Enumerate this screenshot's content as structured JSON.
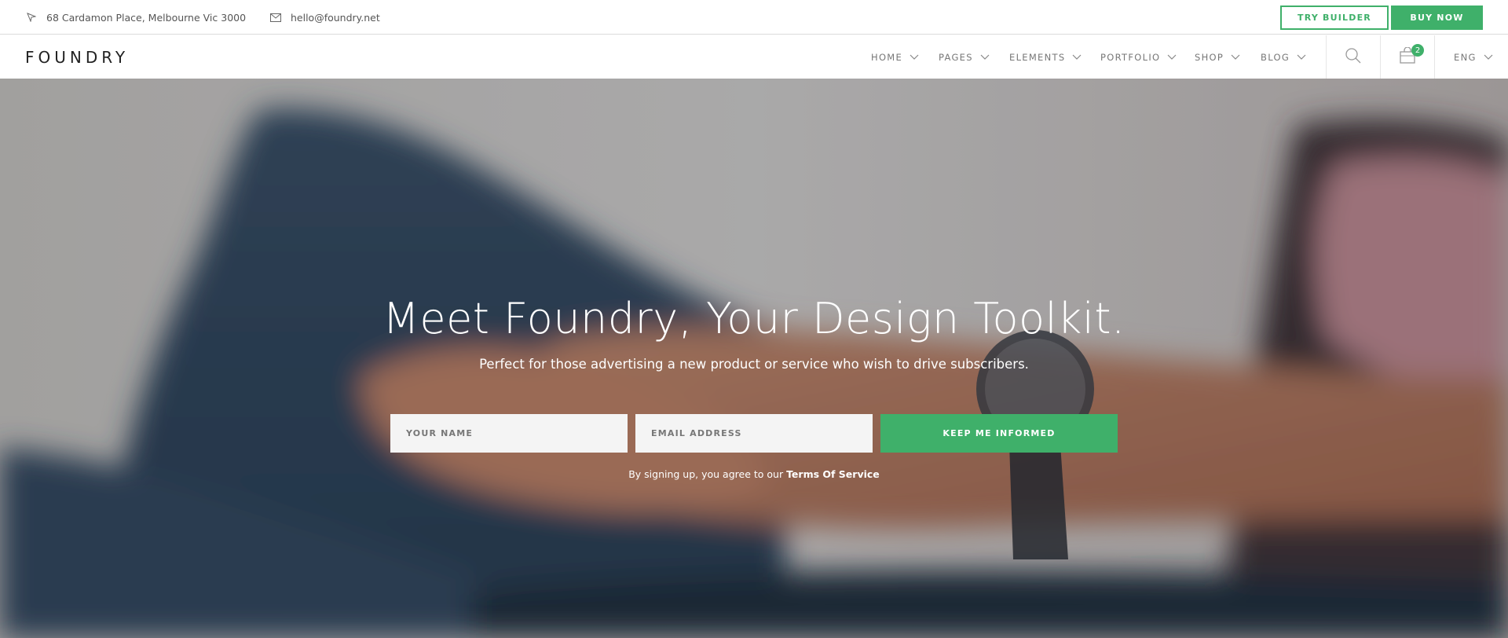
{
  "topbar": {
    "address": "68 Cardamon Place, Melbourne Vic 3000",
    "email": "hello@foundry.net",
    "try_builder": "TRY BUILDER",
    "buy_now": "BUY NOW"
  },
  "nav": {
    "logo": "FOUNDRY",
    "items": [
      {
        "label": "HOME"
      },
      {
        "label": "PAGES"
      },
      {
        "label": "ELEMENTS"
      },
      {
        "label": "PORTFOLIO"
      },
      {
        "label": "SHOP"
      },
      {
        "label": "BLOG"
      }
    ],
    "cart_count": "2",
    "language": "ENG"
  },
  "hero": {
    "title": "Meet Foundry, Your Design Toolkit.",
    "subtitle": "Perfect for those advertising a new product or service who wish to drive subscribers.",
    "name_placeholder": "YOUR NAME",
    "email_placeholder": "EMAIL ADDRESS",
    "submit_label": "KEEP ME INFORMED",
    "terms_prefix": "By signing up, you agree to our ",
    "terms_link": "Terms Of Service"
  },
  "colors": {
    "accent": "#3fb06a",
    "text_dark": "#222222",
    "text_muted": "#777777"
  },
  "icons": {
    "address": "map-pointer-icon",
    "email": "envelope-icon",
    "menu_dropdown": "chevron-down-icon",
    "search": "search-icon",
    "cart": "shopping-bag-icon"
  }
}
